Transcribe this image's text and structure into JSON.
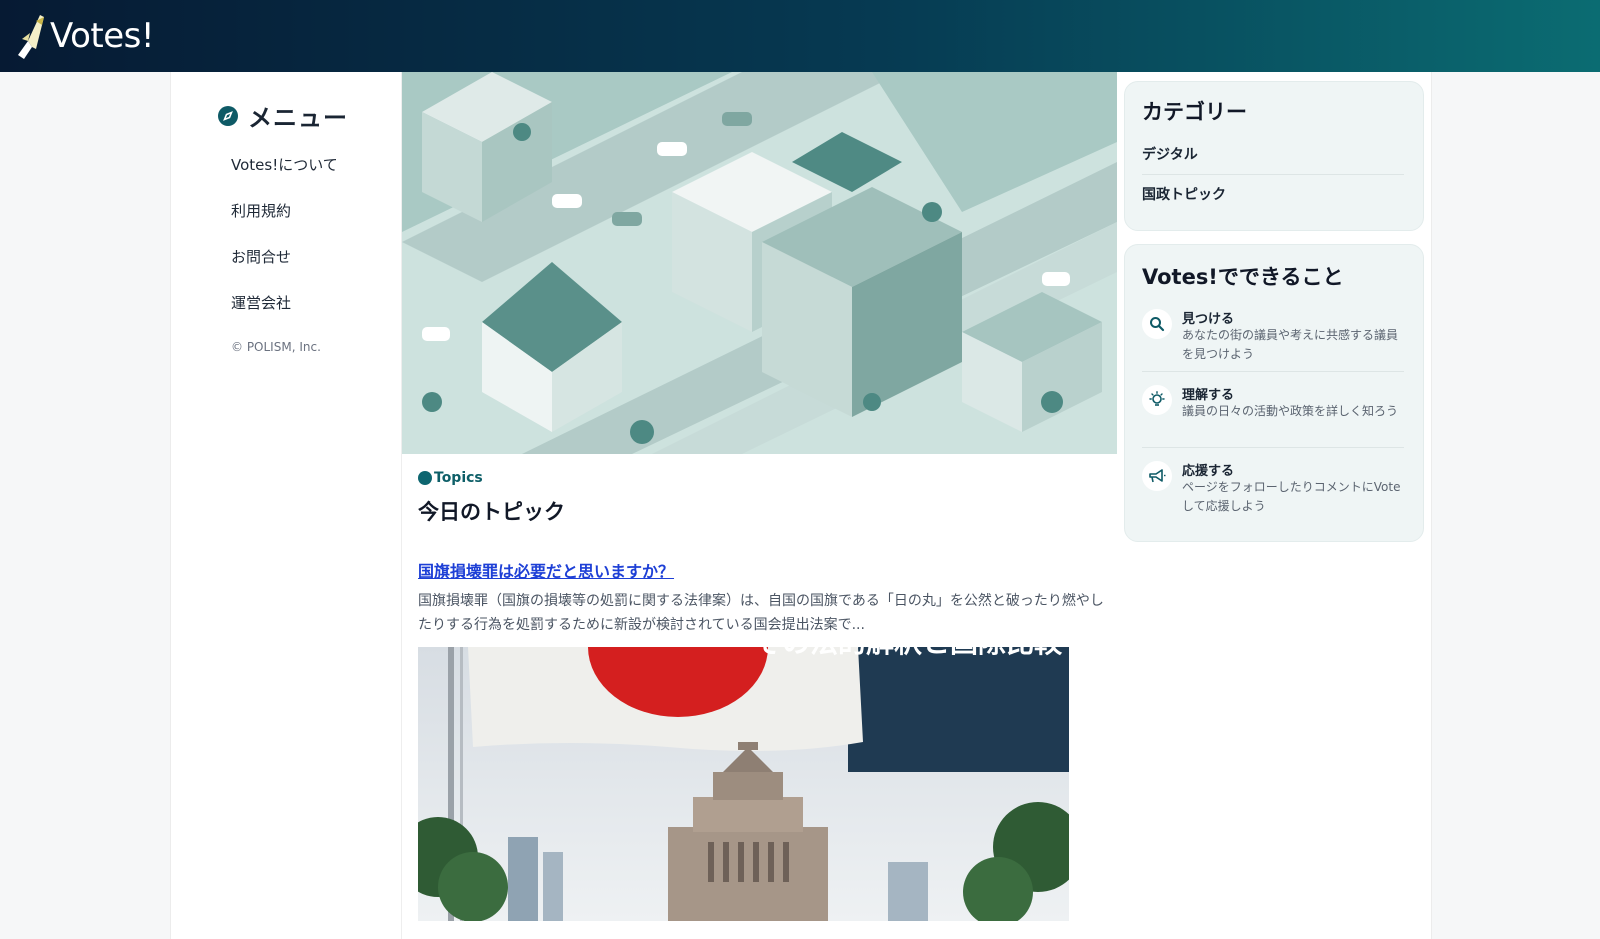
{
  "header": {
    "logo_text": "Votes!"
  },
  "menu": {
    "title": "メニュー",
    "items": [
      {
        "label": "Votes!について"
      },
      {
        "label": "利用規約"
      },
      {
        "label": "お問合せ"
      },
      {
        "label": "運営会社"
      }
    ],
    "copyright": "© POLISM, Inc."
  },
  "topics": {
    "label": "Topics",
    "title": "今日のトピック",
    "article": {
      "title": "国旗損壊罪は必要だと思いますか？",
      "snippet": "国旗損壊罪（国旗の損壊等の処罰に関する法律案）は、自国の国旗である「日の丸」を公然と破ったり燃やしたりする行為を処罰するために新設が検討されている国会提出法案で...",
      "image_caption": "その法的解釈と国際比較"
    }
  },
  "categories": {
    "title": "カテゴリー",
    "items": [
      {
        "label": "デジタル"
      },
      {
        "label": "国政トピック"
      }
    ]
  },
  "features": {
    "title": "Votes!でできること",
    "items": [
      {
        "icon": "search-icon",
        "title": "見つける",
        "desc": "あなたの街の議員や考えに共感する議員を見つけよう"
      },
      {
        "icon": "lightbulb-icon",
        "title": "理解する",
        "desc": "議員の日々の活動や政策を詳しく知ろう"
      },
      {
        "icon": "megaphone-icon",
        "title": "応援する",
        "desc": "ページをフォローしたりコメントにVoteして応援しよう"
      }
    ]
  },
  "colors": {
    "accent": "#0e5a66",
    "link": "#1d3fd6",
    "header_start": "#061a33",
    "header_end": "#0b6c72"
  }
}
